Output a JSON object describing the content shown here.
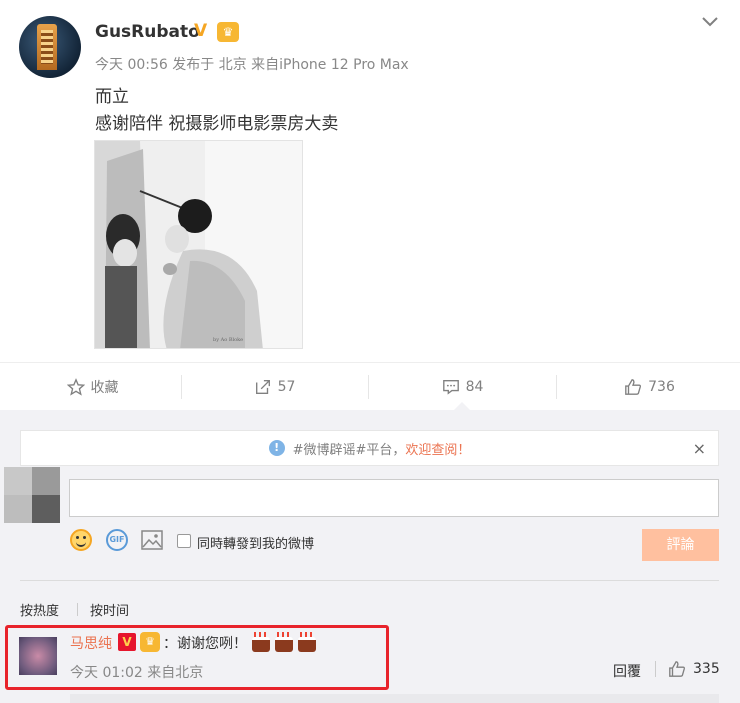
{
  "post": {
    "username": "GusRubato",
    "verified_badge": "V",
    "member_badge": "crown-icon",
    "meta": "今天 00:56 发布于 北京 来自iPhone 12 Pro Max",
    "text_line1": "而立",
    "text_line2": "感谢陪伴 祝摄影师电影票房大卖",
    "photo_signature": "by Ao Bloke"
  },
  "actions": {
    "favorite_label": "收藏",
    "repost_count": "57",
    "comment_count": "84",
    "like_count": "736"
  },
  "comment_box": {
    "notice_prefix": "#微博辟谣#平台，",
    "notice_highlight": "欢迎查阅！",
    "notice_close": "×",
    "input_value": "",
    "repost_checkbox_label": "同時轉發到我的微博",
    "submit_label": "評論",
    "gif_label": "GIF"
  },
  "sort": {
    "hot": "按热度",
    "time": "按时间"
  },
  "comment": {
    "username": "马思纯",
    "verified_badge": "V",
    "text": "：谢谢您咧！",
    "emoji": [
      "cake-icon",
      "cake-icon",
      "cake-icon"
    ],
    "time": "今天 01:02 来自北京",
    "reply_label": "回覆",
    "like_count": "335"
  },
  "colors": {
    "accent_orange": "#eb7350",
    "highlight_border": "#e8232b",
    "submit_disabled": "#ffc09f",
    "background_gray": "#f2f2f5"
  }
}
